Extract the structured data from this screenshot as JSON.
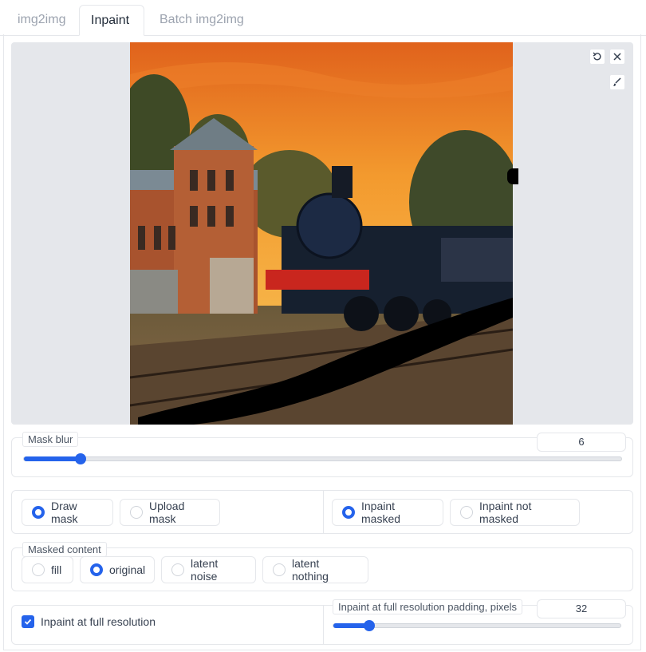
{
  "tabs": [
    {
      "label": "img2img",
      "active": false
    },
    {
      "label": "Inpaint",
      "active": true
    },
    {
      "label": "Batch img2img",
      "active": false
    }
  ],
  "editor": {
    "tools": [
      "undo-icon",
      "close-icon",
      "brush-icon"
    ]
  },
  "mask_blur": {
    "label": "Mask blur",
    "value": "6",
    "min": 0,
    "max": 64,
    "fraction": 0.094
  },
  "mask_mode": {
    "options": [
      "Draw mask",
      "Upload mask"
    ],
    "selected": "Draw mask"
  },
  "inpaint_mode": {
    "options": [
      "Inpaint masked",
      "Inpaint not masked"
    ],
    "selected": "Inpaint masked"
  },
  "masked_content": {
    "label": "Masked content",
    "options": [
      "fill",
      "original",
      "latent noise",
      "latent nothing"
    ],
    "selected": "original"
  },
  "full_res": {
    "checkbox_label": "Inpaint at full resolution",
    "checked": true,
    "padding_label": "Inpaint at full resolution padding, pixels",
    "padding_value": "32",
    "fraction": 0.125
  },
  "colors": {
    "accent": "#2563eb",
    "border": "#e5e7eb",
    "sky": "#f39a2e"
  }
}
